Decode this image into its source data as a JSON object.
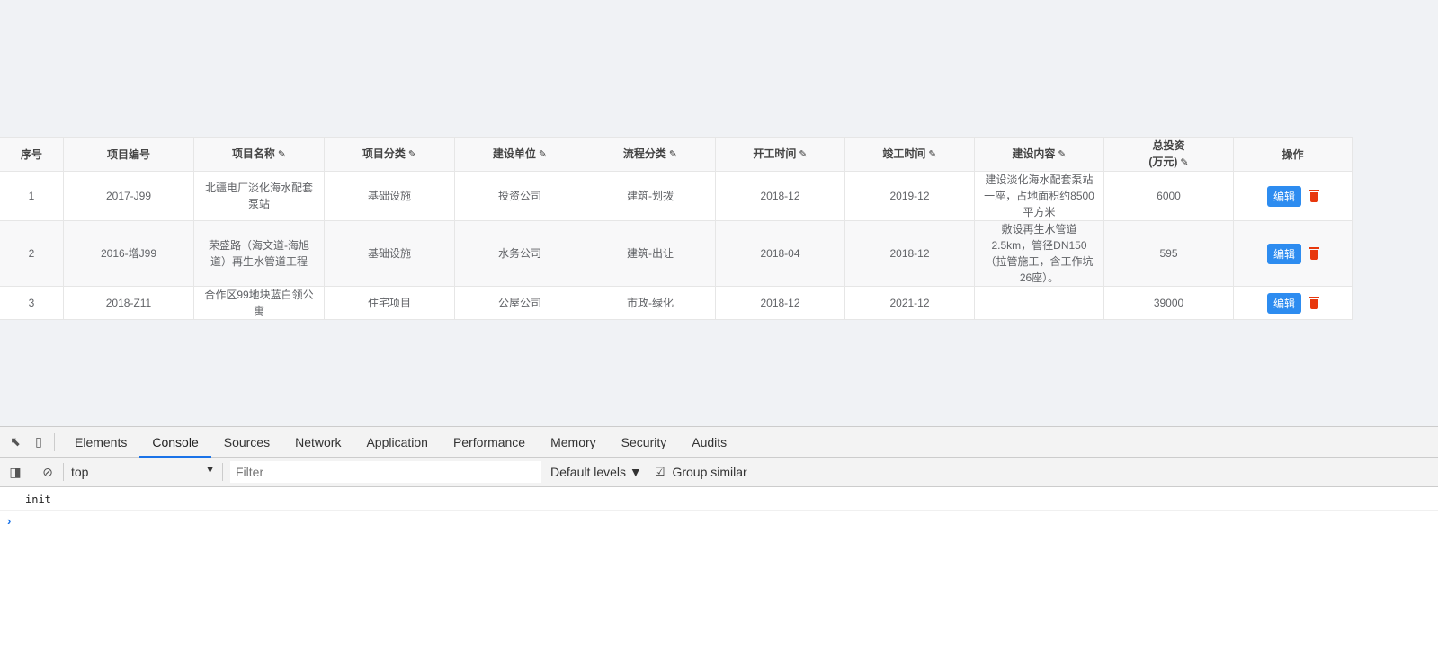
{
  "table": {
    "headers": [
      "序号",
      "项目编号",
      "项目名称",
      "项目分类",
      "建设单位",
      "流程分类",
      "开工时间",
      "竣工时间",
      "建设内容",
      "总投资",
      "(万元)",
      "操作"
    ],
    "rows": [
      {
        "no": "1",
        "code": "2017-J99",
        "name": "北疆电厂淡化海水配套泵站",
        "category": "基础设施",
        "unit": "投资公司",
        "flow": "建筑-划拨",
        "start": "2018-12",
        "end": "2019-12",
        "content": "建设淡化海水配套泵站一座，占地面积约8500平方米",
        "invest": "6000"
      },
      {
        "no": "2",
        "code": "2016-增J99",
        "name": "荣盛路（海文道-海旭道）再生水管道工程",
        "category": "基础设施",
        "unit": "水务公司",
        "flow": "建筑-出让",
        "start": "2018-04",
        "end": "2018-12",
        "content": "敷设再生水管道2.5km，管径DN150（拉管施工，含工作坑26座）。",
        "invest": "595"
      },
      {
        "no": "3",
        "code": "2018-Z11",
        "name": "合作区99地块蓝白领公寓",
        "category": "住宅项目",
        "unit": "公屋公司",
        "flow": "市政-绿化",
        "start": "2018-12",
        "end": "2021-12",
        "content": "",
        "invest": "39000"
      }
    ],
    "edit_label": "编辑"
  },
  "devtools": {
    "tabs": [
      "Elements",
      "Console",
      "Sources",
      "Network",
      "Application",
      "Performance",
      "Memory",
      "Security",
      "Audits"
    ],
    "context": "top",
    "filter_placeholder": "Filter",
    "levels": "Default levels ▼",
    "group_similar": "Group similar",
    "log": "init"
  }
}
